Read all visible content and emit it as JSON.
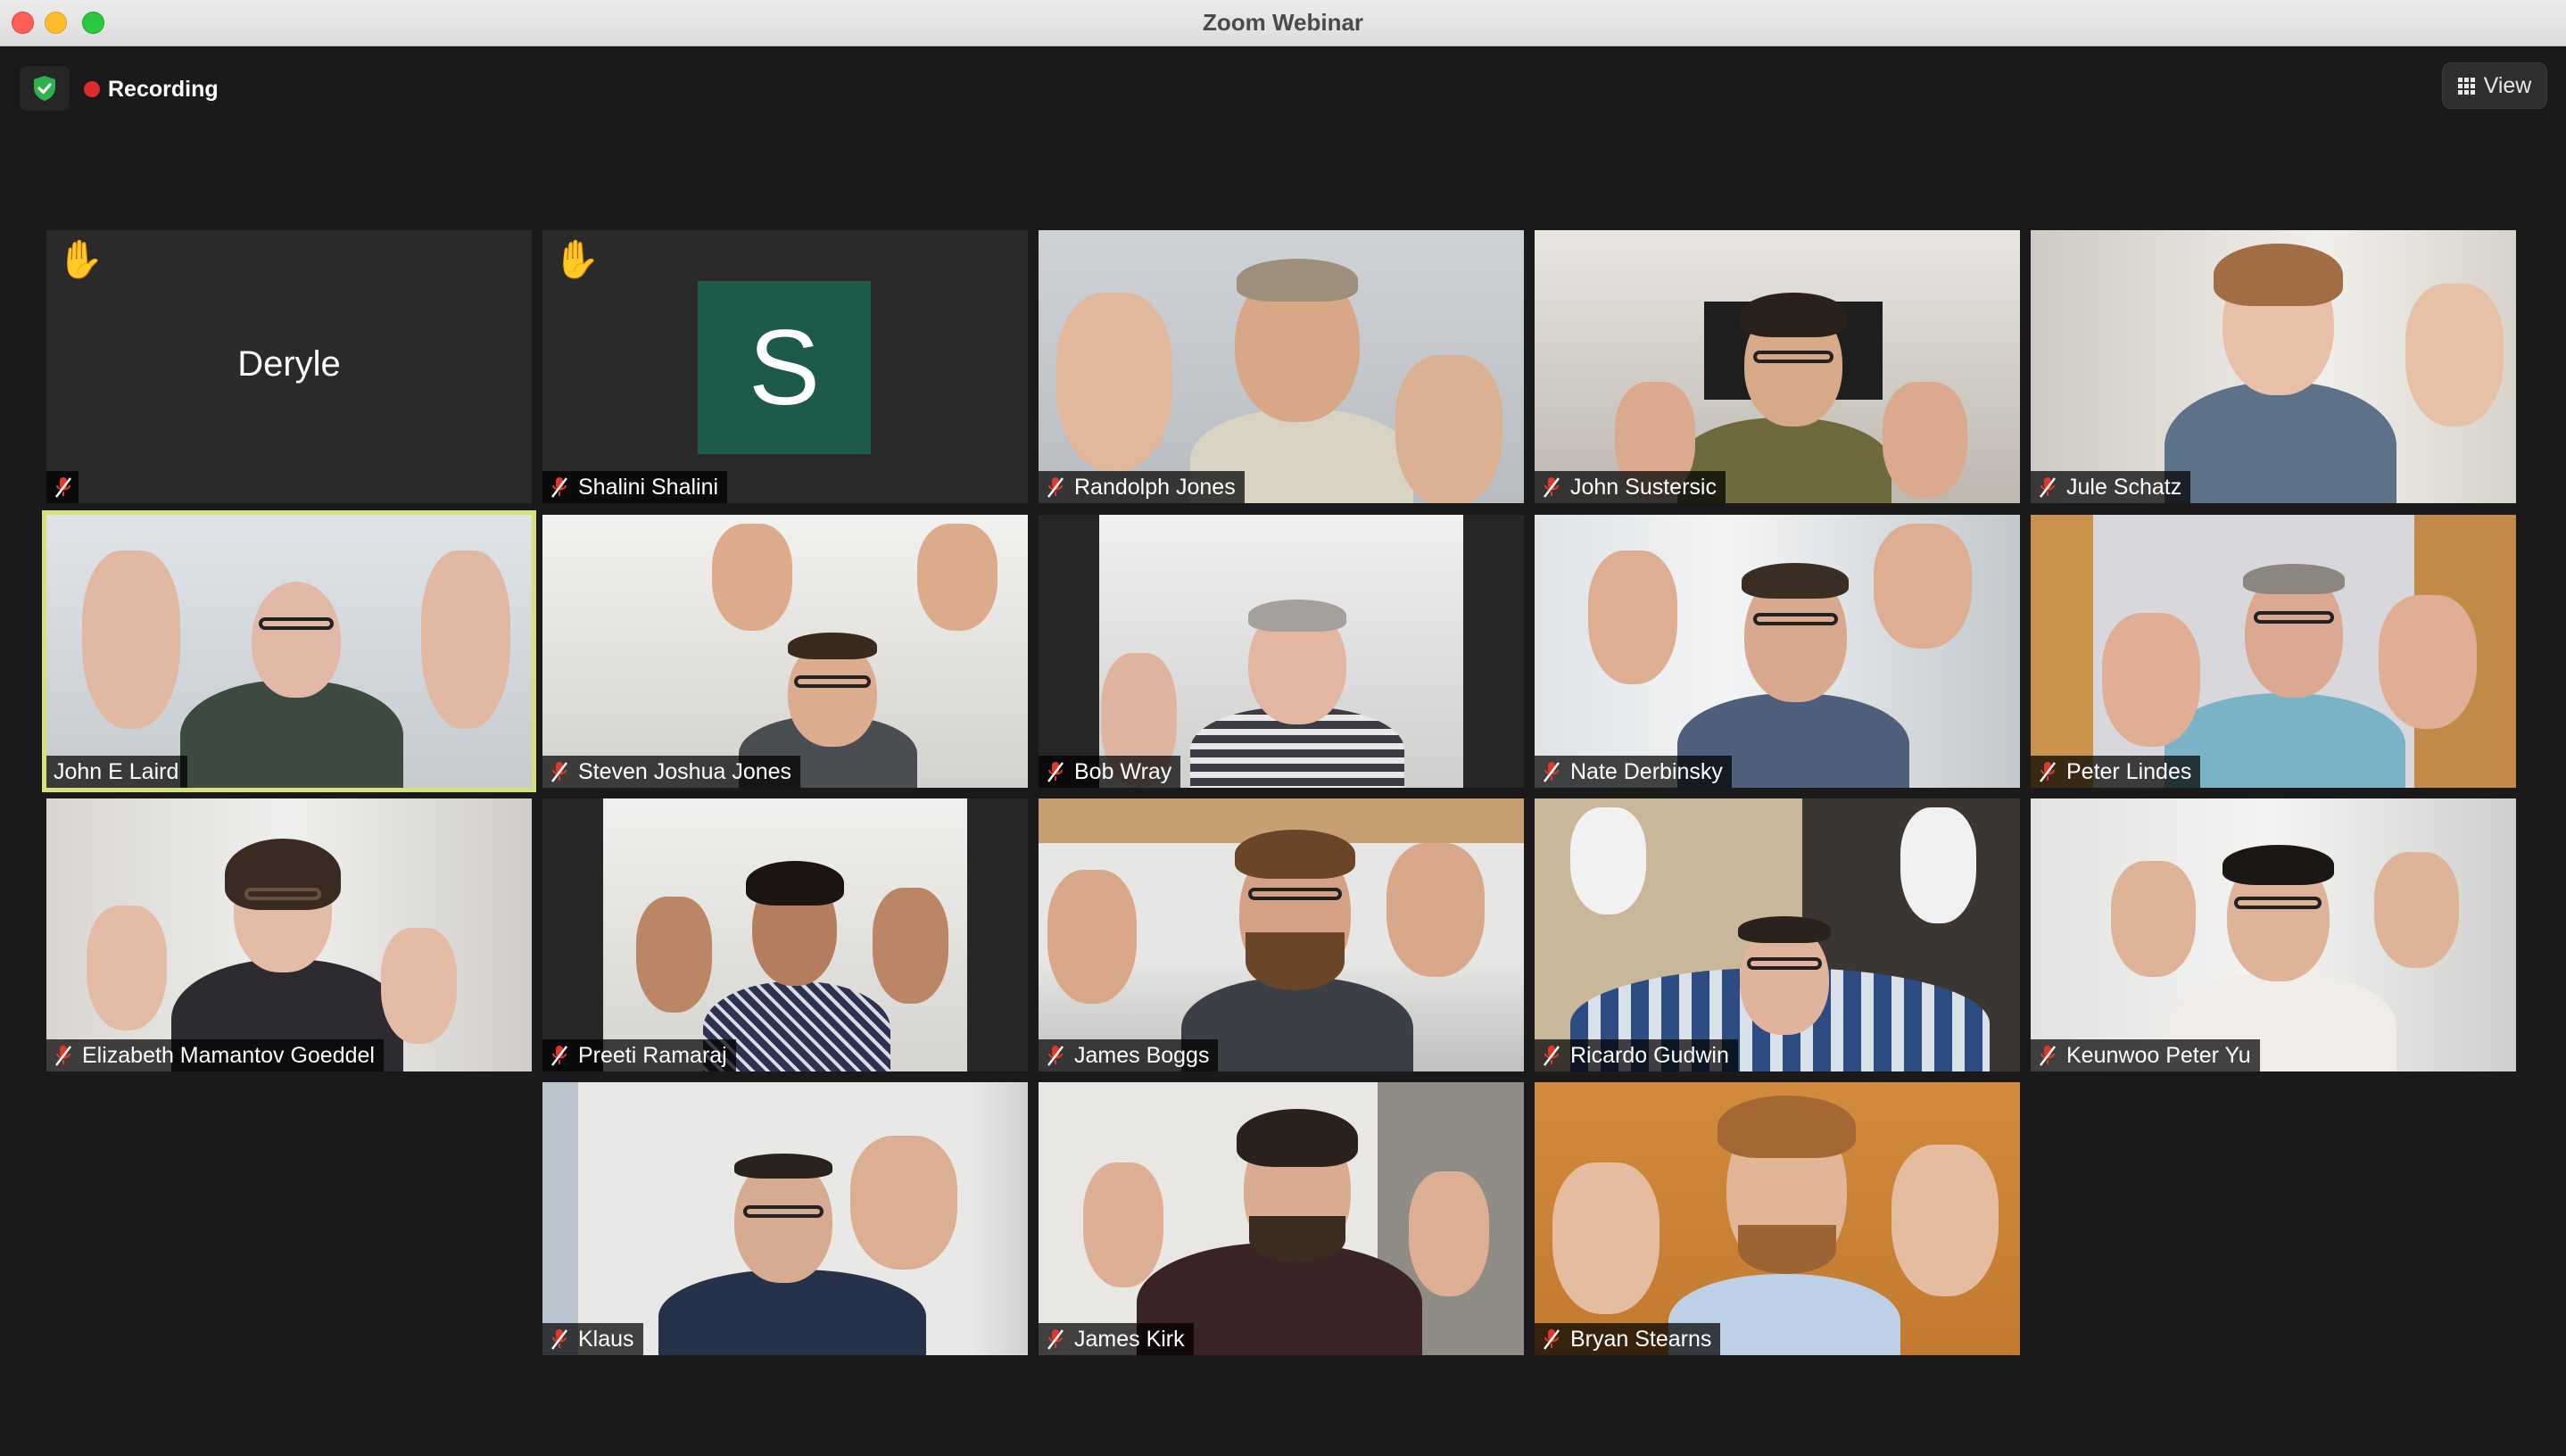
{
  "window": {
    "title": "Zoom Webinar",
    "controls": [
      "close",
      "minimize",
      "maximize"
    ]
  },
  "topbar": {
    "security_icon": "shield-check-icon",
    "recording_label": "Recording",
    "recording_color": "#e02b2b",
    "view_label": "View",
    "view_icon": "grid-icon"
  },
  "colors": {
    "background": "#1a1a1a",
    "active_speaker_border": "#d8e07a",
    "avatar_s": "#1e5a4c",
    "mute_icon": "#e0392b"
  },
  "participants": [
    {
      "name": "Deryle",
      "video": false,
      "hand_raised": true,
      "muted": true,
      "show_label_text": false
    },
    {
      "name": "Shalini Shalini",
      "video": false,
      "avatar_letter": "S",
      "hand_raised": true,
      "muted": true
    },
    {
      "name": "Randolph Jones",
      "video": true,
      "muted": true
    },
    {
      "name": "John Sustersic",
      "video": true,
      "muted": true
    },
    {
      "name": "Jule Schatz",
      "video": true,
      "muted": true
    },
    {
      "name": "John E Laird",
      "video": true,
      "muted": false,
      "active_speaker": true
    },
    {
      "name": "Steven Joshua Jones",
      "video": true,
      "muted": true
    },
    {
      "name": "Bob Wray",
      "video": true,
      "muted": true
    },
    {
      "name": "Nate Derbinsky",
      "video": true,
      "muted": true
    },
    {
      "name": "Peter Lindes",
      "video": true,
      "muted": true
    },
    {
      "name": "Elizabeth Mamantov Goeddel",
      "video": true,
      "muted": true
    },
    {
      "name": "Preeti Ramaraj",
      "video": true,
      "muted": true
    },
    {
      "name": "James Boggs",
      "video": true,
      "muted": true
    },
    {
      "name": "Ricardo Gudwin",
      "video": true,
      "muted": true
    },
    {
      "name": "Keunwoo Peter Yu",
      "video": true,
      "muted": true
    },
    {
      "name": "Klaus",
      "video": true,
      "muted": true
    },
    {
      "name": "James Kirk",
      "video": true,
      "muted": true
    },
    {
      "name": "Bryan Stearns",
      "video": true,
      "muted": true
    }
  ]
}
